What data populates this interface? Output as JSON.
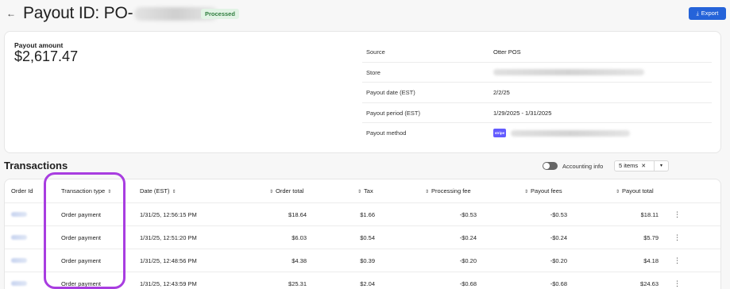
{
  "header": {
    "back_icon": "←",
    "title_prefix": "Payout ID: PO-",
    "status": "Processed",
    "export_label": "Export",
    "export_icon": "⤓"
  },
  "summary": {
    "payout_amount_label": "Payout amount",
    "payout_amount_value": "$2,617.47",
    "details": [
      {
        "label": "Source",
        "value": "Otter POS"
      },
      {
        "label": "Store",
        "value": ""
      },
      {
        "label": "Payout date (EST)",
        "value": "2/2/25"
      },
      {
        "label": "Payout period (EST)",
        "value": "1/29/2025 - 1/31/2025"
      },
      {
        "label": "Payout method",
        "value": "",
        "logo": "stripe"
      }
    ]
  },
  "transactions": {
    "title": "Transactions",
    "accounting_info_label": "Accounting info",
    "items_filter": "5 items",
    "columns": {
      "order_id": "Order Id",
      "transaction_type": "Transaction type",
      "date": "Date (EST)",
      "order_total": "Order total",
      "tax": "Tax",
      "processing_fee": "Processing fee",
      "payout_fees": "Payout fees",
      "payout_total": "Payout total"
    },
    "rows": [
      {
        "type": "Order payment",
        "date": "1/31/25, 12:56:15 PM",
        "order_total": "$18.64",
        "tax": "$1.66",
        "processing_fee": "-$0.53",
        "payout_fees": "-$0.53",
        "payout_total": "$18.11"
      },
      {
        "type": "Order payment",
        "date": "1/31/25, 12:51:20 PM",
        "order_total": "$6.03",
        "tax": "$0.54",
        "processing_fee": "-$0.24",
        "payout_fees": "-$0.24",
        "payout_total": "$5.79"
      },
      {
        "type": "Order payment",
        "date": "1/31/25, 12:48:56 PM",
        "order_total": "$4.38",
        "tax": "$0.39",
        "processing_fee": "-$0.20",
        "payout_fees": "-$0.20",
        "payout_total": "$4.18"
      },
      {
        "type": "Order payment",
        "date": "1/31/25, 12:43:59 PM",
        "order_total": "$25.31",
        "tax": "$2.04",
        "processing_fee": "-$0.68",
        "payout_fees": "-$0.68",
        "payout_total": "$24.63"
      }
    ]
  },
  "colors": {
    "accent": "#2563d9",
    "processed_bg": "#e2f3e5",
    "processed_text": "#2f7d3e",
    "highlight": "#a83de0",
    "stripe": "#635bff"
  }
}
